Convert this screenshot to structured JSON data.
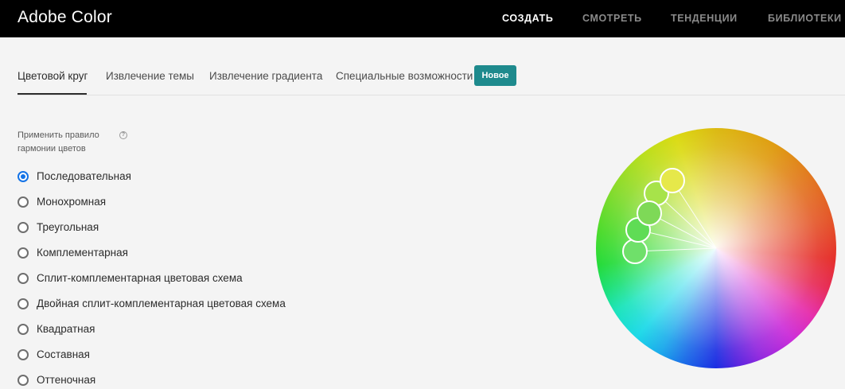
{
  "header": {
    "brand": "Adobe Color",
    "nav": [
      {
        "label": "СОЗДАТЬ",
        "active": true
      },
      {
        "label": "СМОТРЕТЬ",
        "active": false
      },
      {
        "label": "ТЕНДЕНЦИИ",
        "active": false
      },
      {
        "label": "БИБЛИОТЕКИ",
        "active": false
      }
    ]
  },
  "tabs": [
    {
      "label": "Цветовой круг",
      "active": true
    },
    {
      "label": "Извлечение темы",
      "active": false
    },
    {
      "label": "Извлечение градиента",
      "active": false
    },
    {
      "label": "Специальные возможности",
      "active": false
    }
  ],
  "new_badge": "Новое",
  "harmony": {
    "label": "Применить правило гармонии цветов",
    "help_icon": "?",
    "options": [
      {
        "label": "Последовательная",
        "selected": true
      },
      {
        "label": "Монохромная",
        "selected": false
      },
      {
        "label": "Треугольная",
        "selected": false
      },
      {
        "label": "Комплементарная",
        "selected": false
      },
      {
        "label": "Сплит-комплементарная цветовая схема",
        "selected": false
      },
      {
        "label": "Двойная сплит-комплементарная цветовая схема",
        "selected": false
      },
      {
        "label": "Квадратная",
        "selected": false
      },
      {
        "label": "Составная",
        "selected": false
      },
      {
        "label": "Оттеночная",
        "selected": false
      }
    ]
  },
  "wheel": {
    "icon": "color-wheel",
    "markers": [
      {
        "color": "#e6e84a",
        "base": true
      },
      {
        "color": "#a7e34a",
        "base": false
      },
      {
        "color": "#7ed957",
        "base": false
      },
      {
        "color": "#5fdc55",
        "base": false
      },
      {
        "color": "#6fe06a",
        "base": false
      }
    ]
  }
}
